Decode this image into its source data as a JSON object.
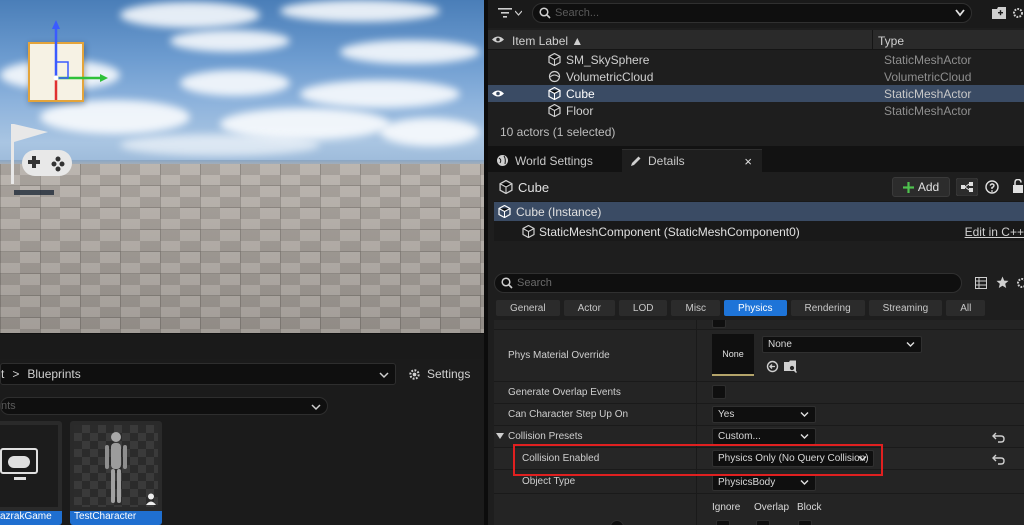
{
  "content_browser": {
    "breadcrumb_partial": "t",
    "breadcrumb_sep": ">",
    "breadcrumb_folder": "Blueprints",
    "settings_label": "Settings",
    "search_partial": "nts",
    "assets": [
      {
        "name": "azrakGame"
      },
      {
        "name": "TestCharacter"
      }
    ]
  },
  "outliner": {
    "search_placeholder": "Search...",
    "col_label": "Item Label ▲",
    "col_type": "Type",
    "rows": [
      {
        "label": "SM_SkySphere",
        "type": "StaticMeshActor",
        "selected": false
      },
      {
        "label": "VolumetricCloud",
        "type": "VolumetricCloud",
        "selected": false
      },
      {
        "label": "Cube",
        "type": "StaticMeshActor",
        "selected": true
      },
      {
        "label": "Floor",
        "type": "StaticMeshActor",
        "selected": false
      }
    ],
    "status": "10 actors (1 selected)"
  },
  "tabs": {
    "world_settings": "World Settings",
    "details": "Details",
    "close": "×"
  },
  "details": {
    "title": "Cube",
    "add_label": "Add",
    "instance_label": "Cube (Instance)",
    "component_label": "StaticMeshComponent (StaticMeshComponent0)",
    "edit_cpp": "Edit in C++",
    "search_placeholder": "Search",
    "filter_tabs": [
      "General",
      "Actor",
      "LOD",
      "Misc",
      "Physics",
      "Rendering",
      "Streaming",
      "All"
    ],
    "active_filter": "Physics",
    "properties": {
      "phys_material_label": "Phys Material Override",
      "phys_material_thumb": "None",
      "phys_material_value": "None",
      "gen_overlap_label": "Generate Overlap Events",
      "step_up_label": "Can Character Step Up On",
      "step_up_value": "Yes",
      "collision_presets_label": "Collision Presets",
      "collision_presets_value": "Custom...",
      "collision_enabled_label": "Collision Enabled",
      "collision_enabled_value": "Physics Only (No Query Collision)",
      "object_type_label": "Object Type",
      "object_type_value": "PhysicsBody",
      "response_headers": [
        "Ignore",
        "Overlap",
        "Block"
      ]
    }
  },
  "colors": {
    "accent_blue": "#1e74d8",
    "selection": "#3a4b64",
    "highlight_red": "#e02020",
    "add_green": "#4ec24e"
  }
}
